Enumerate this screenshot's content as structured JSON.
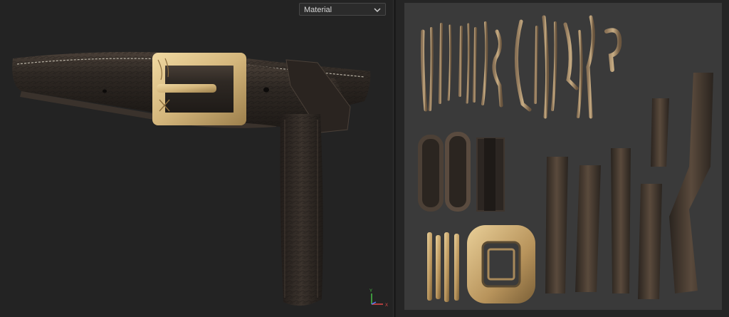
{
  "viewport3d": {
    "channel_dropdown": {
      "selected": "Material"
    },
    "axis_gizmo": {
      "y_label": "Y",
      "x_label": "X"
    }
  },
  "colors": {
    "background": "#232323",
    "uv_panel": "#3a3a3a",
    "leather": "#2c2622",
    "leather_highlight": "#4a4038",
    "stitching": "#b9b3a6",
    "brass": "#d9bf86",
    "axis_x": "#e04848",
    "axis_y": "#46c046",
    "axis_z": "#4f7cff"
  },
  "icons": {
    "dropdown": "chevron-down-icon",
    "gizmo": "axis-gizmo-icon"
  }
}
